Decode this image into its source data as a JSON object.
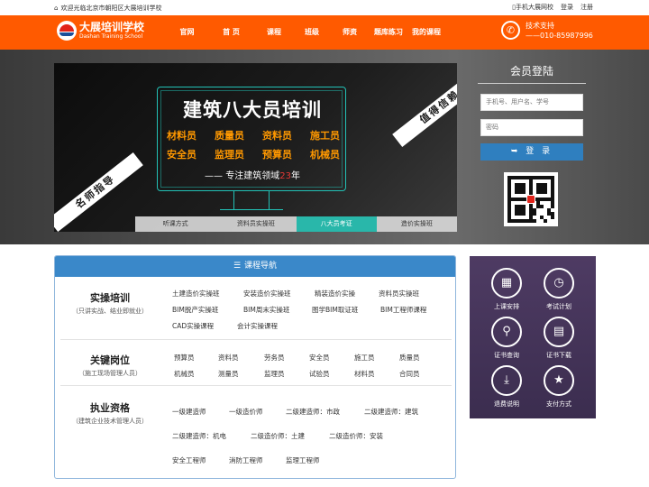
{
  "topbar": {
    "welcome": "欢迎光临北京市朝阳区大展培训学校",
    "mobile": "手机大展网校",
    "login": "登录",
    "register": "注册"
  },
  "logo": {
    "name": "大展培训学校",
    "en": "Dashan Training School"
  },
  "menu": [
    "官网",
    "首 页",
    "课程",
    "班级",
    "师资",
    "题库练习",
    "我的课程"
  ],
  "support": {
    "label": "技术支持",
    "phone": "——010-85987996"
  },
  "banner": {
    "title": "建筑八大员培训",
    "row1": [
      "材料员",
      "质量员",
      "资料员",
      "施工员"
    ],
    "row2": [
      "安全员",
      "监理员",
      "预算员",
      "机械员"
    ],
    "slogan_pre": "—— 专注建筑领域",
    "slogan_num": "23",
    "slogan_post": "年",
    "ribbon_left": "名师指导",
    "ribbon_right": "值得信赖",
    "tabs": [
      "听课方式",
      "资料员实操班",
      "八大员考证",
      "造价实操班"
    ],
    "active_tab": 2
  },
  "login": {
    "title": "会员登陆",
    "user_placeholder": "手机号、用户名、学号",
    "pass_placeholder": "密码",
    "button": "登 录"
  },
  "courses": {
    "header": "课程导航",
    "groups": [
      {
        "title": "实操培训",
        "subtitle": "（只讲实战、结业即就业）",
        "links": [
          "土建造价实操班",
          "安装造价实操班",
          "精装造价实操",
          "资料员实操班",
          "BIM脱产实操班",
          "BIM周末实操班",
          "图学BIM取证班",
          "BIM工程师课程",
          "CAD实操课程",
          "会计实操课程"
        ]
      },
      {
        "title": "关键岗位",
        "subtitle": "（施工现场管理人员）",
        "links": [
          "预算员",
          "资料员",
          "劳务员",
          "安全员",
          "施工员",
          "质量员",
          "机械员",
          "测量员",
          "监理员",
          "试验员",
          "材料员",
          "合同员"
        ]
      },
      {
        "title": "执业资格",
        "subtitle": "（建筑企业技术管理人员）",
        "links": [
          "一级建造师",
          "一级造价师",
          "二级建造师：市政",
          "二级建造师：建筑",
          "二级建造师：机电",
          "二级造价师：土建",
          "二级造价师：安装",
          "安全工程师",
          "消防工程师",
          "监理工程师"
        ]
      }
    ]
  },
  "side": [
    {
      "label": "上课安排",
      "icon": "calendar-icon"
    },
    {
      "label": "考试计划",
      "icon": "clock-icon"
    },
    {
      "label": "证书查询",
      "icon": "search-icon"
    },
    {
      "label": "证书下载",
      "icon": "document-icon"
    },
    {
      "label": "退费说明",
      "icon": "download-icon"
    },
    {
      "label": "支付方式",
      "icon": "star-icon"
    }
  ]
}
